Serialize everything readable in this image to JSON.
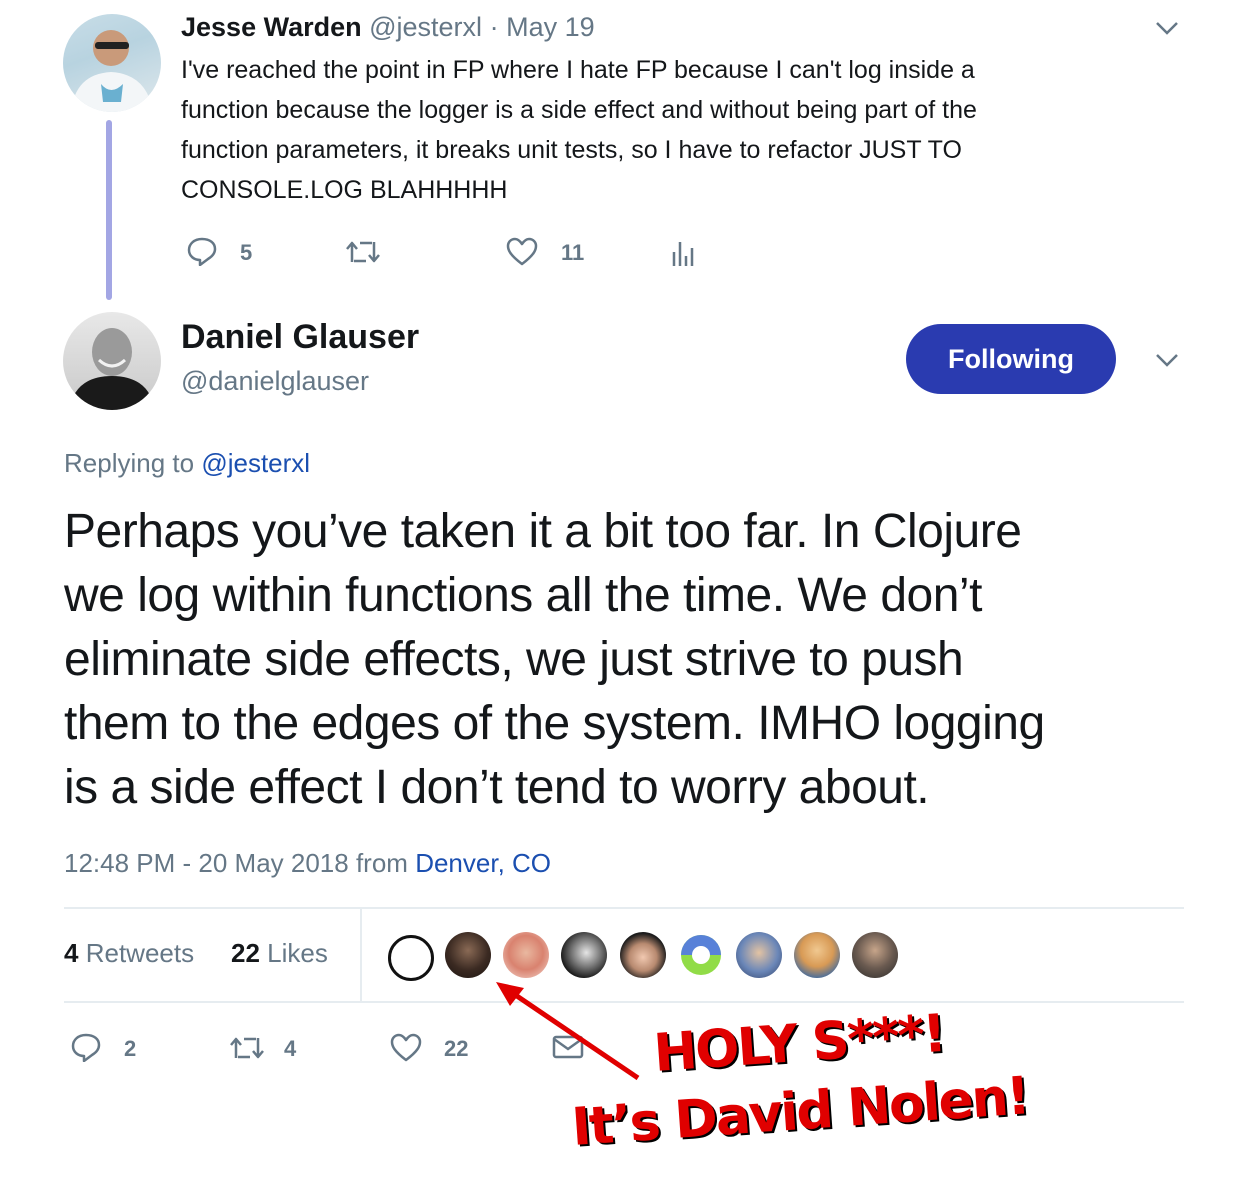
{
  "parent_tweet": {
    "name": "Jesse Warden",
    "handle": "@jesterxl",
    "separator": "·",
    "date": "May 19",
    "text_lines": [
      "I've reached the point in FP where I hate FP because I can't log inside a",
      "function because the logger is a side effect and without being part of the",
      "function parameters, it breaks unit tests, so I have to refactor JUST TO",
      "CONSOLE.LOG BLAHHHHH"
    ],
    "replies": "5",
    "likes": "11"
  },
  "main_tweet": {
    "name": "Daniel Glauser",
    "handle": "@danielglauser",
    "follow_label": "Following",
    "replying_prefix": "Replying to",
    "replying_handle": "@jesterxl",
    "text_lines": [
      "Perhaps you’ve taken it a bit too far. In Clojure",
      "we log within functions all the time. We don’t",
      "eliminate side effects, we just strive to push",
      "them to the edges of the system. IMHO logging",
      "is a side effect I don’t tend to worry about."
    ],
    "timestamp": "12:48 PM - 20 May 2018 from",
    "location": "Denver, CO",
    "retweets_count": "4",
    "retweets_label": "Retweets",
    "likes_count": "22",
    "likes_label": "Likes",
    "reply_count": "2",
    "retweet_count": "4",
    "like_count": "22"
  },
  "annotation": {
    "line1": "HOLY S***!",
    "line2": "It’s David Nolen!",
    "color": "#e00000"
  },
  "colors": {
    "follow_button": "#2a3bb0",
    "thread_line": "#a3a6e4",
    "link": "#1b4fb0"
  }
}
